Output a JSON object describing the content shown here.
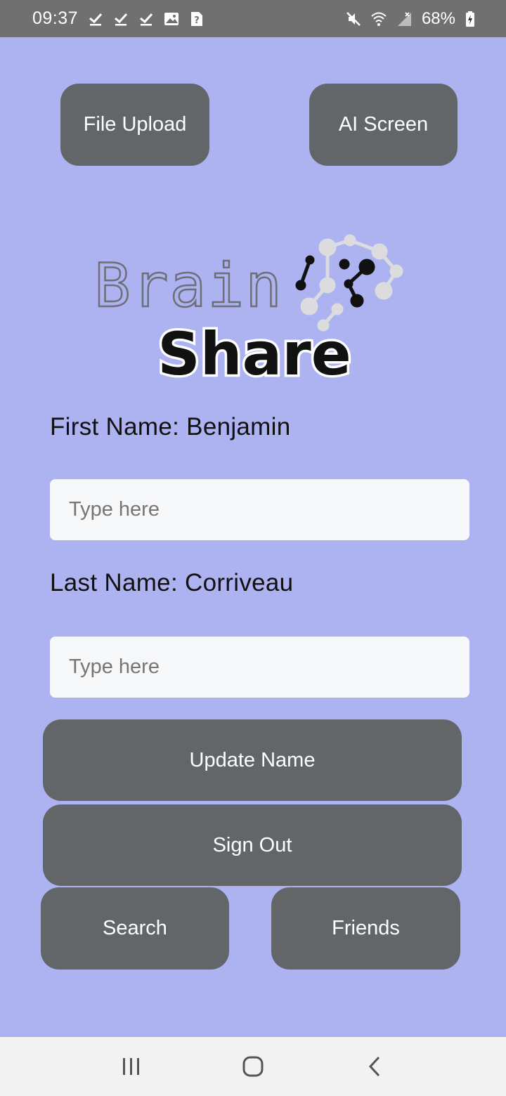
{
  "status_bar": {
    "time": "09:37",
    "battery": "68%",
    "icons": [
      "check-icon",
      "check-icon",
      "check-icon",
      "image-icon",
      "unknown-app-icon",
      "mute-icon",
      "wifi-icon",
      "no-signal-icon",
      "battery-charging-icon"
    ]
  },
  "header_buttons": {
    "file_upload": "File Upload",
    "ai_screen": "AI Screen"
  },
  "logo": {
    "brain": "Brain",
    "share": "Share"
  },
  "profile": {
    "first_name_label": "First Name: Benjamin",
    "first_name_placeholder": "Type here",
    "last_name_label": "Last Name: Corriveau",
    "last_name_placeholder": "Type here"
  },
  "actions": {
    "update_name": "Update Name",
    "sign_out": "Sign Out",
    "search": "Search",
    "friends": "Friends"
  },
  "navigation": {
    "icons": [
      "recent-apps-icon",
      "home-icon",
      "back-icon"
    ]
  },
  "colors": {
    "background": "#adb2f1",
    "button": "#636669",
    "status_bar": "#707070",
    "input": "#f7f8fa"
  }
}
